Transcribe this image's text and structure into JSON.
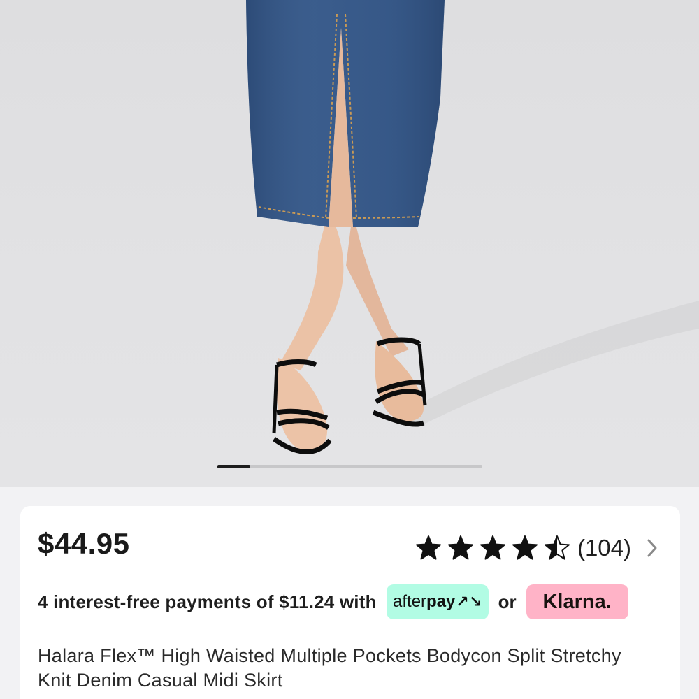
{
  "product": {
    "price": "$44.95",
    "title": "Halara Flex™ High Waisted Multiple Pockets Bodycon Split Stretchy Knit Denim Casual Midi Skirt"
  },
  "rating": {
    "value": 4.5,
    "max": 5,
    "review_count": "(104)"
  },
  "payments": {
    "text": "4 interest-free payments of $11.24 with",
    "or_label": "or",
    "afterpay_label_light": "after",
    "afterpay_label_bold": "pay",
    "afterpay_mark": "↗↘",
    "klarna_label": "Klarna."
  },
  "carousel": {
    "current_index": 1,
    "total_images": 8
  },
  "colors": {
    "afterpay_bg": "#b2fce4",
    "klarna_bg": "#ffb3c7",
    "star": "#111111",
    "denim": "#385a8a"
  },
  "icons": {
    "star": "star-icon",
    "half_star": "star-half-icon",
    "chevron": "chevron-right-icon"
  }
}
